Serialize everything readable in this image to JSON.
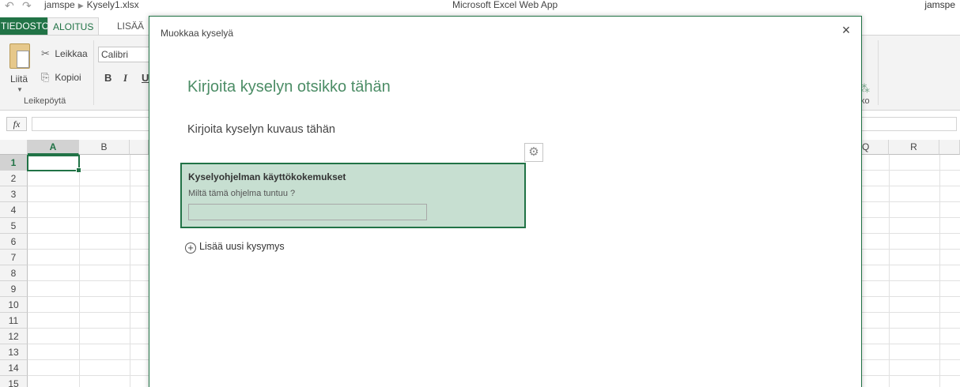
{
  "titlebar": {
    "user_folder": "jamspe",
    "file_name": "Kysely1.xlsx",
    "app_title": "Microsoft Excel Web App",
    "user": "jamspe"
  },
  "tabs": {
    "file": "TIEDOSTO",
    "home": "ALOITUS",
    "insert": "LISÄÄ"
  },
  "ribbon": {
    "paste_label": "Liitä",
    "cut_label": "Leikkaa",
    "copy_label": "Kopioi",
    "clipboard_group": "Leikepöytä",
    "font_name": "Calibri",
    "bold": "B",
    "italic": "I",
    "underline": "U",
    "right_group_fragment": "ko"
  },
  "formula_bar": {
    "fx": "fx"
  },
  "grid": {
    "columns_left": [
      "A",
      "B"
    ],
    "columns_right": [
      "Q",
      "R"
    ],
    "rows": [
      "1",
      "2",
      "3",
      "4",
      "5",
      "6",
      "7",
      "8",
      "9",
      "10",
      "11",
      "12",
      "13",
      "14",
      "15"
    ]
  },
  "dialog": {
    "title": "Muokkaa kyselyä",
    "close": "×",
    "survey_title": "Kirjoita kyselyn otsikko tähän",
    "survey_description": "Kirjoita kyselyn kuvaus tähän",
    "question": {
      "title": "Kyselyohjelman käyttökokemukset",
      "subtitle": "Miltä tämä ohjelma tuntuu ?",
      "answer_value": ""
    },
    "add_question": "Lisää uusi kysymys"
  },
  "colors": {
    "accent": "#217346",
    "title_green": "#4c8d66",
    "question_bg": "#c7dfd1"
  },
  "icons": {
    "undo": "undo-icon",
    "redo": "redo-icon",
    "cut": "scissors-icon",
    "copy": "copy-icon",
    "gear": "gear-icon",
    "close": "close-icon",
    "add": "plus-circle-icon"
  }
}
